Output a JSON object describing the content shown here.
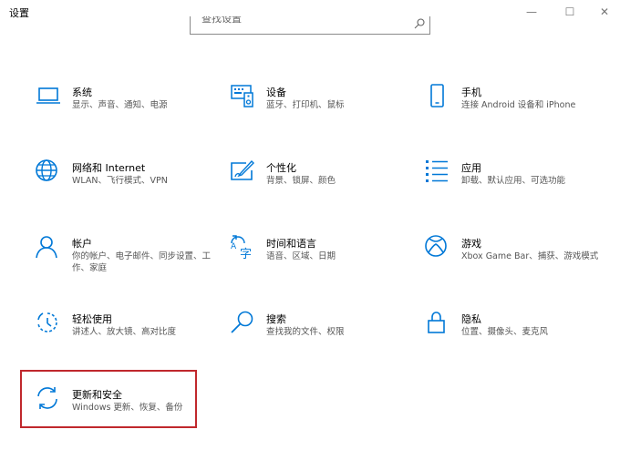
{
  "window": {
    "title": "设置",
    "minimize_glyph": "—",
    "maximize_glyph": "☐",
    "close_glyph": "✕"
  },
  "search": {
    "placeholder": "查找设置"
  },
  "colors": {
    "accent": "#0078d7",
    "highlight": "#c0282d"
  },
  "categories": [
    {
      "label": "系统",
      "desc": "显示、声音、通知、电源",
      "icon": "laptop-icon"
    },
    {
      "label": "设备",
      "desc": "蓝牙、打印机、鼠标",
      "icon": "devices-icon"
    },
    {
      "label": "手机",
      "desc": "连接 Android 设备和 iPhone",
      "icon": "phone-icon"
    },
    {
      "label": "网络和 Internet",
      "desc": "WLAN、飞行模式、VPN",
      "icon": "globe-icon"
    },
    {
      "label": "个性化",
      "desc": "背景、锁屏、颜色",
      "icon": "paint-icon"
    },
    {
      "label": "应用",
      "desc": "卸载、默认应用、可选功能",
      "icon": "apps-list-icon"
    },
    {
      "label": "帐户",
      "desc": "你的帐户、电子邮件、同步设置、工作、家庭",
      "icon": "person-icon"
    },
    {
      "label": "时间和语言",
      "desc": "语音、区域、日期",
      "icon": "time-language-icon"
    },
    {
      "label": "游戏",
      "desc": "Xbox Game Bar、捕获、游戏模式",
      "icon": "xbox-icon"
    },
    {
      "label": "轻松使用",
      "desc": "讲述人、放大镜、高对比度",
      "icon": "ease-of-access-icon"
    },
    {
      "label": "搜索",
      "desc": "查找我的文件、权限",
      "icon": "search-icon"
    },
    {
      "label": "隐私",
      "desc": "位置、摄像头、麦克风",
      "icon": "lock-icon"
    },
    {
      "label": "更新和安全",
      "desc": "Windows 更新、恢复、备份",
      "icon": "sync-icon"
    }
  ]
}
